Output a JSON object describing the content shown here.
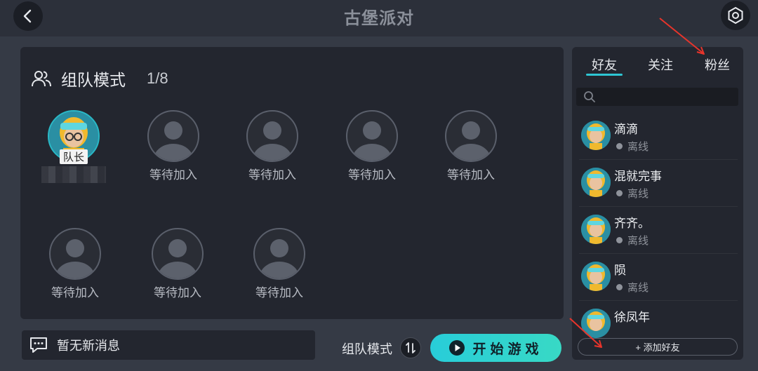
{
  "header": {
    "title": "古堡派对"
  },
  "team": {
    "mode_label": "组队模式",
    "count": "1/8",
    "captain_badge": "队长",
    "waiting_label": "等待加入"
  },
  "bottom": {
    "message_text": "暂无新消息",
    "mode_label": "组队模式",
    "start_label": "开始游戏"
  },
  "friends_panel": {
    "tabs": [
      {
        "label": "好友",
        "active": true
      },
      {
        "label": "关注",
        "active": false
      },
      {
        "label": "粉丝",
        "active": false
      }
    ],
    "search_placeholder": "",
    "friends": [
      {
        "name": "滴滴",
        "status": "离线"
      },
      {
        "name": "混就完事",
        "status": "离线"
      },
      {
        "name": "齐齐。",
        "status": "离线"
      },
      {
        "name": "陨",
        "status": "离线"
      },
      {
        "name": "徐凤年",
        "status": ""
      }
    ],
    "add_friend_label": "+ 添加好友"
  },
  "colors": {
    "accent": "#2ec6d3",
    "start_button": "#2fd3cf",
    "annotation_arrow": "#e8342b"
  }
}
